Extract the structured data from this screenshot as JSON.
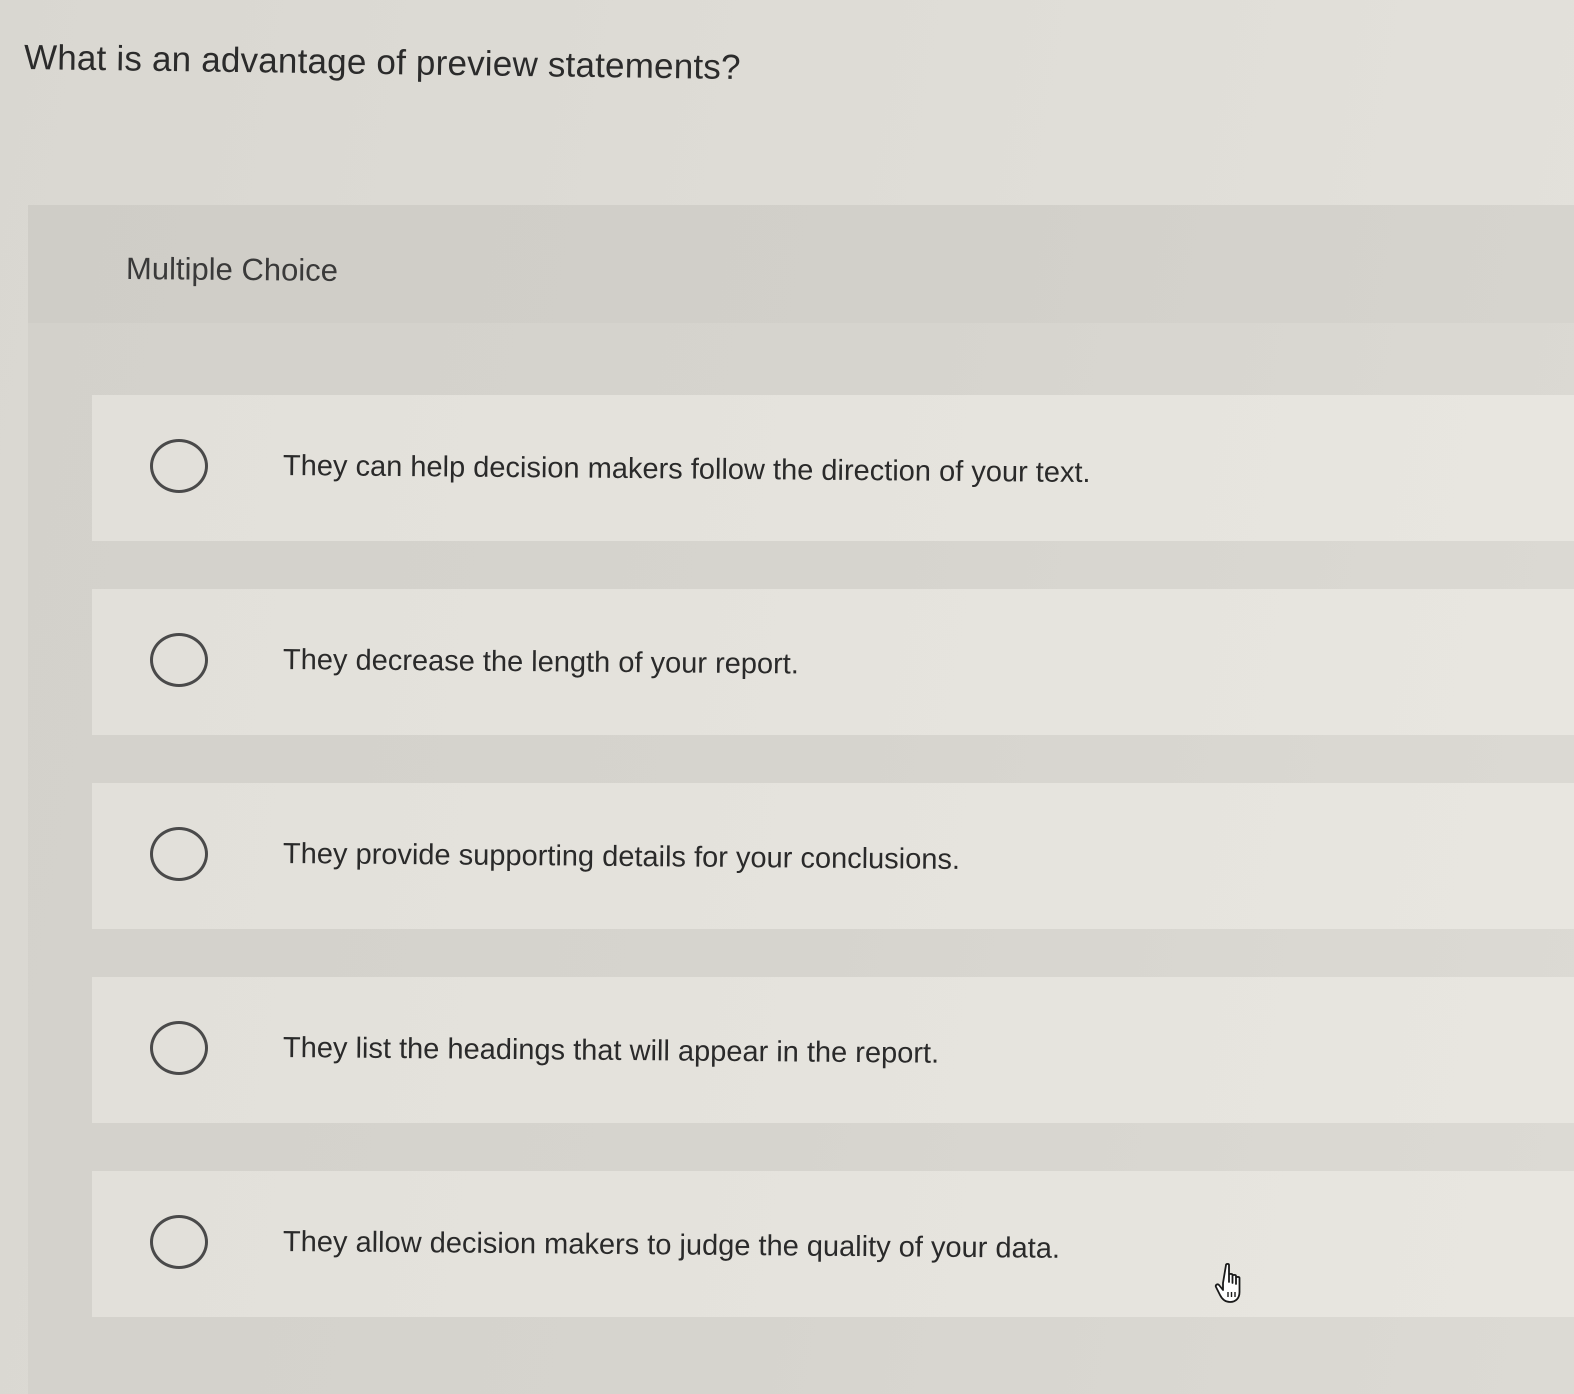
{
  "question": {
    "title": "What is an advantage of preview statements?"
  },
  "panel": {
    "label": "Multiple Choice"
  },
  "options": [
    {
      "label": "They can help decision makers follow the direction of your text.",
      "selected": false
    },
    {
      "label": "They decrease the length of your report.",
      "selected": false
    },
    {
      "label": "They provide supporting details for your conclusions.",
      "selected": false
    },
    {
      "label": "They list the headings that will appear in the report.",
      "selected": false
    },
    {
      "label": "They allow decision makers to judge the quality of your data.",
      "selected": false
    }
  ],
  "cursor": {
    "icon": "hand-pointer-icon"
  }
}
